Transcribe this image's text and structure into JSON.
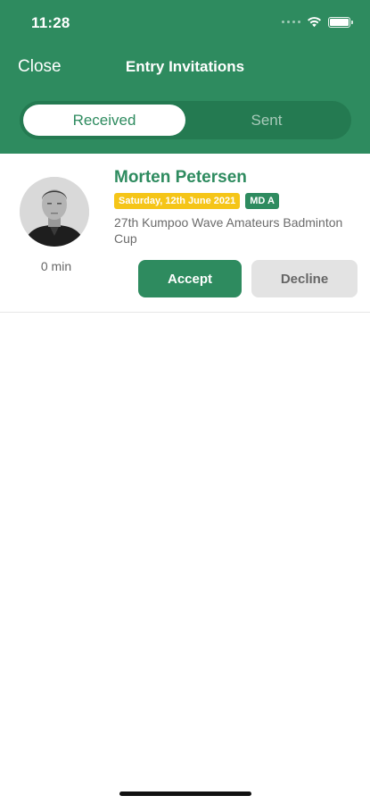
{
  "status_bar": {
    "time": "11:28",
    "icons": [
      "cellular-signal-icon",
      "wifi-icon",
      "battery-icon"
    ]
  },
  "nav": {
    "close_label": "Close",
    "title": "Entry Invitations"
  },
  "tabs": {
    "received_label": "Received",
    "sent_label": "Sent",
    "selected": "Received"
  },
  "invitations": [
    {
      "name": "Morten Petersen",
      "date": "Saturday, 12th June 2021",
      "category": "MD A",
      "tournament": "27th Kumpoo Wave Amateurs Badminton Cup",
      "elapsed": "0 min",
      "accept_label": "Accept",
      "decline_label": "Decline"
    }
  ],
  "colors": {
    "brand_green": "#2e8b5f",
    "date_badge": "#f5c518",
    "decline_bg": "#e3e3e3"
  }
}
